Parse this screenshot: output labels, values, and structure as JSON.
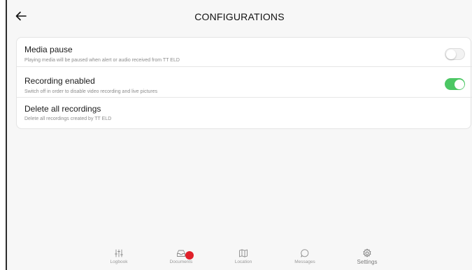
{
  "header": {
    "title": "CONFIGURATIONS",
    "back_icon": "arrow-left-icon"
  },
  "settings": [
    {
      "title": "Media pause",
      "subtitle": "Playing media will be paused when alert or audio received from TT ELD",
      "toggle": "off"
    },
    {
      "title": "Recording enabled",
      "subtitle": "Switch off in order to disable video recording and live pictures",
      "toggle": "on"
    },
    {
      "title": "Delete all recordings",
      "subtitle": "Delete all recordings created by TT ELD"
    }
  ],
  "colors": {
    "toggle_on": "#4cc764",
    "badge": "#e0202a"
  },
  "nav": [
    {
      "label": "Logbook",
      "icon": "sliders-icon"
    },
    {
      "label": "Documents",
      "icon": "inbox-icon",
      "badge": true
    },
    {
      "label": "Location",
      "icon": "map-icon"
    },
    {
      "label": "Messages",
      "icon": "chat-bubble-icon"
    },
    {
      "label": "Settings",
      "icon": "gear-icon",
      "active": true
    }
  ]
}
